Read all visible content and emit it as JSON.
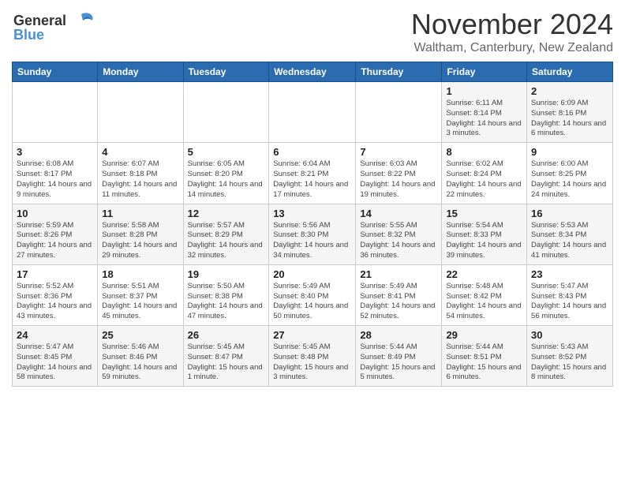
{
  "logo": {
    "line1": "General",
    "line2": "Blue"
  },
  "title": "November 2024",
  "location": "Waltham, Canterbury, New Zealand",
  "header": {
    "days": [
      "Sunday",
      "Monday",
      "Tuesday",
      "Wednesday",
      "Thursday",
      "Friday",
      "Saturday"
    ]
  },
  "weeks": [
    [
      {
        "day": "",
        "info": ""
      },
      {
        "day": "",
        "info": ""
      },
      {
        "day": "",
        "info": ""
      },
      {
        "day": "",
        "info": ""
      },
      {
        "day": "",
        "info": ""
      },
      {
        "day": "1",
        "info": "Sunrise: 6:11 AM\nSunset: 8:14 PM\nDaylight: 14 hours and 3 minutes."
      },
      {
        "day": "2",
        "info": "Sunrise: 6:09 AM\nSunset: 8:16 PM\nDaylight: 14 hours and 6 minutes."
      }
    ],
    [
      {
        "day": "3",
        "info": "Sunrise: 6:08 AM\nSunset: 8:17 PM\nDaylight: 14 hours and 9 minutes."
      },
      {
        "day": "4",
        "info": "Sunrise: 6:07 AM\nSunset: 8:18 PM\nDaylight: 14 hours and 11 minutes."
      },
      {
        "day": "5",
        "info": "Sunrise: 6:05 AM\nSunset: 8:20 PM\nDaylight: 14 hours and 14 minutes."
      },
      {
        "day": "6",
        "info": "Sunrise: 6:04 AM\nSunset: 8:21 PM\nDaylight: 14 hours and 17 minutes."
      },
      {
        "day": "7",
        "info": "Sunrise: 6:03 AM\nSunset: 8:22 PM\nDaylight: 14 hours and 19 minutes."
      },
      {
        "day": "8",
        "info": "Sunrise: 6:02 AM\nSunset: 8:24 PM\nDaylight: 14 hours and 22 minutes."
      },
      {
        "day": "9",
        "info": "Sunrise: 6:00 AM\nSunset: 8:25 PM\nDaylight: 14 hours and 24 minutes."
      }
    ],
    [
      {
        "day": "10",
        "info": "Sunrise: 5:59 AM\nSunset: 8:26 PM\nDaylight: 14 hours and 27 minutes."
      },
      {
        "day": "11",
        "info": "Sunrise: 5:58 AM\nSunset: 8:28 PM\nDaylight: 14 hours and 29 minutes."
      },
      {
        "day": "12",
        "info": "Sunrise: 5:57 AM\nSunset: 8:29 PM\nDaylight: 14 hours and 32 minutes."
      },
      {
        "day": "13",
        "info": "Sunrise: 5:56 AM\nSunset: 8:30 PM\nDaylight: 14 hours and 34 minutes."
      },
      {
        "day": "14",
        "info": "Sunrise: 5:55 AM\nSunset: 8:32 PM\nDaylight: 14 hours and 36 minutes."
      },
      {
        "day": "15",
        "info": "Sunrise: 5:54 AM\nSunset: 8:33 PM\nDaylight: 14 hours and 39 minutes."
      },
      {
        "day": "16",
        "info": "Sunrise: 5:53 AM\nSunset: 8:34 PM\nDaylight: 14 hours and 41 minutes."
      }
    ],
    [
      {
        "day": "17",
        "info": "Sunrise: 5:52 AM\nSunset: 8:36 PM\nDaylight: 14 hours and 43 minutes."
      },
      {
        "day": "18",
        "info": "Sunrise: 5:51 AM\nSunset: 8:37 PM\nDaylight: 14 hours and 45 minutes."
      },
      {
        "day": "19",
        "info": "Sunrise: 5:50 AM\nSunset: 8:38 PM\nDaylight: 14 hours and 47 minutes."
      },
      {
        "day": "20",
        "info": "Sunrise: 5:49 AM\nSunset: 8:40 PM\nDaylight: 14 hours and 50 minutes."
      },
      {
        "day": "21",
        "info": "Sunrise: 5:49 AM\nSunset: 8:41 PM\nDaylight: 14 hours and 52 minutes."
      },
      {
        "day": "22",
        "info": "Sunrise: 5:48 AM\nSunset: 8:42 PM\nDaylight: 14 hours and 54 minutes."
      },
      {
        "day": "23",
        "info": "Sunrise: 5:47 AM\nSunset: 8:43 PM\nDaylight: 14 hours and 56 minutes."
      }
    ],
    [
      {
        "day": "24",
        "info": "Sunrise: 5:47 AM\nSunset: 8:45 PM\nDaylight: 14 hours and 58 minutes."
      },
      {
        "day": "25",
        "info": "Sunrise: 5:46 AM\nSunset: 8:46 PM\nDaylight: 14 hours and 59 minutes."
      },
      {
        "day": "26",
        "info": "Sunrise: 5:45 AM\nSunset: 8:47 PM\nDaylight: 15 hours and 1 minute."
      },
      {
        "day": "27",
        "info": "Sunrise: 5:45 AM\nSunset: 8:48 PM\nDaylight: 15 hours and 3 minutes."
      },
      {
        "day": "28",
        "info": "Sunrise: 5:44 AM\nSunset: 8:49 PM\nDaylight: 15 hours and 5 minutes."
      },
      {
        "day": "29",
        "info": "Sunrise: 5:44 AM\nSunset: 8:51 PM\nDaylight: 15 hours and 6 minutes."
      },
      {
        "day": "30",
        "info": "Sunrise: 5:43 AM\nSunset: 8:52 PM\nDaylight: 15 hours and 8 minutes."
      }
    ]
  ]
}
